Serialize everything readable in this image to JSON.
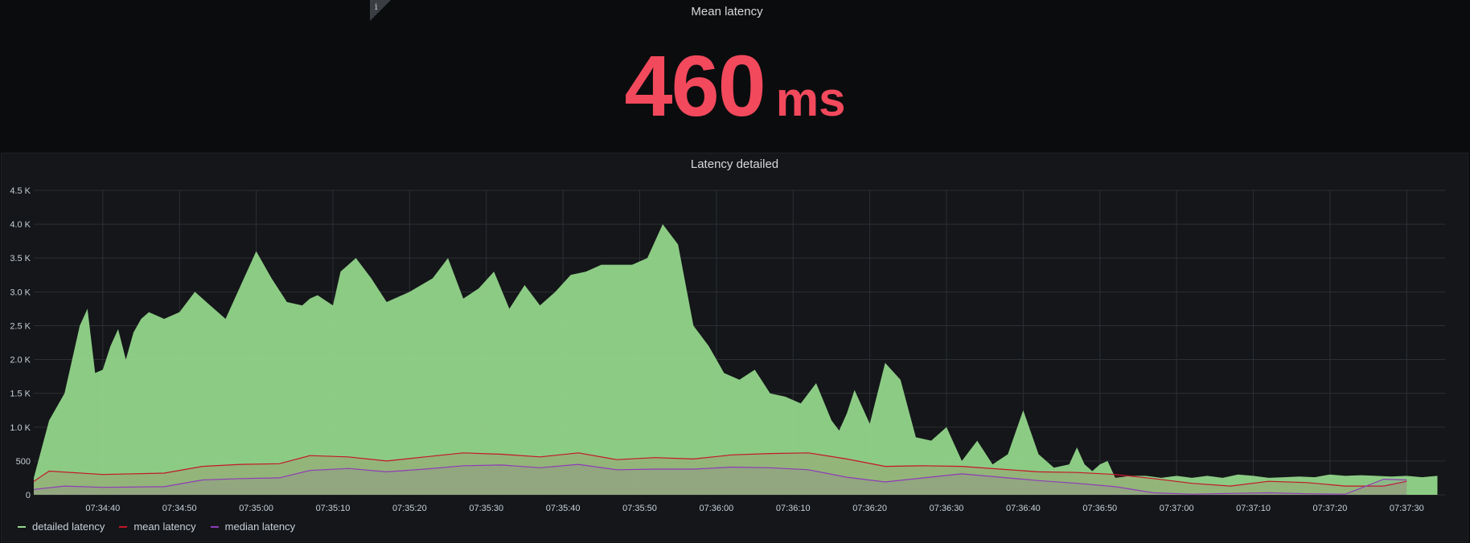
{
  "stat_panel": {
    "title": "Mean latency",
    "value": "460",
    "unit": "ms",
    "value_color": "#f2495c",
    "info_icon": "i"
  },
  "graph_panel": {
    "title": "Latency detailed"
  },
  "chart_data": {
    "type": "area",
    "title": "Latency detailed",
    "ylim": [
      0,
      4500
    ],
    "y_ticks": [
      "0",
      "500",
      "1.0 K",
      "1.5 K",
      "2.0 K",
      "2.5 K",
      "3.0 K",
      "3.5 K",
      "4.0 K",
      "4.5 K"
    ],
    "x_ticks": [
      "07:34:40",
      "07:34:50",
      "07:35:00",
      "07:35:10",
      "07:35:20",
      "07:35:30",
      "07:35:40",
      "07:35:50",
      "07:36:00",
      "07:36:10",
      "07:36:20",
      "07:36:30",
      "07:36:40",
      "07:36:50",
      "07:37:00",
      "07:37:10",
      "07:37:20",
      "07:37:30"
    ],
    "grid": true,
    "legend": "bottom-left",
    "series": [
      {
        "name": "detailed latency",
        "color": "#96d98d",
        "style": "area",
        "x": [
          "07:34:31",
          "07:34:33",
          "07:34:35",
          "07:34:36",
          "07:34:37",
          "07:34:38",
          "07:34:39",
          "07:34:40",
          "07:34:41",
          "07:34:42",
          "07:34:43",
          "07:34:44",
          "07:34:45",
          "07:34:46",
          "07:34:47",
          "07:34:48",
          "07:34:50",
          "07:34:52",
          "07:34:54",
          "07:34:56",
          "07:34:58",
          "07:35:00",
          "07:35:02",
          "07:35:04",
          "07:35:06",
          "07:35:07",
          "07:35:08",
          "07:35:10",
          "07:35:11",
          "07:35:13",
          "07:35:15",
          "07:35:17",
          "07:35:20",
          "07:35:23",
          "07:35:25",
          "07:35:27",
          "07:35:29",
          "07:35:31",
          "07:35:33",
          "07:35:35",
          "07:35:37",
          "07:35:39",
          "07:35:41",
          "07:35:43",
          "07:35:45",
          "07:35:47",
          "07:35:49",
          "07:35:51",
          "07:35:53",
          "07:35:55",
          "07:35:57",
          "07:35:59",
          "07:36:01",
          "07:36:03",
          "07:36:05",
          "07:36:07",
          "07:36:09",
          "07:36:11",
          "07:36:13",
          "07:36:15",
          "07:36:16",
          "07:36:17",
          "07:36:18",
          "07:36:20",
          "07:36:22",
          "07:36:24",
          "07:36:26",
          "07:36:28",
          "07:36:30",
          "07:36:32",
          "07:36:34",
          "07:36:36",
          "07:36:38",
          "07:36:40",
          "07:36:42",
          "07:36:44",
          "07:36:46",
          "07:36:47",
          "07:36:48",
          "07:36:49",
          "07:36:50",
          "07:36:51",
          "07:36:52",
          "07:36:54",
          "07:36:56",
          "07:36:58",
          "07:37:00",
          "07:37:02",
          "07:37:04",
          "07:37:06",
          "07:37:08",
          "07:37:10",
          "07:37:12",
          "07:37:14",
          "07:37:16",
          "07:37:18",
          "07:37:20",
          "07:37:22",
          "07:37:24",
          "07:37:26",
          "07:37:28",
          "07:37:30",
          "07:37:32",
          "07:37:34"
        ],
        "values": [
          250,
          1100,
          1500,
          2000,
          2500,
          2750,
          1800,
          1850,
          2200,
          2450,
          2000,
          2400,
          2600,
          2700,
          2650,
          2600,
          2700,
          3000,
          2800,
          2600,
          3100,
          3600,
          3200,
          2850,
          2800,
          2900,
          2950,
          2800,
          3300,
          3500,
          3200,
          2850,
          3000,
          3200,
          3500,
          2900,
          3050,
          3300,
          2750,
          3100,
          2800,
          3000,
          3250,
          3300,
          3400,
          3400,
          3400,
          3500,
          4000,
          3700,
          2500,
          2200,
          1800,
          1700,
          1850,
          1500,
          1450,
          1350,
          1650,
          1100,
          950,
          1200,
          1550,
          1050,
          1950,
          1700,
          850,
          800,
          1000,
          500,
          800,
          450,
          600,
          1250,
          600,
          400,
          450,
          700,
          450,
          350,
          450,
          500,
          250,
          280,
          280,
          250,
          280,
          250,
          280,
          250,
          300,
          280,
          250,
          260,
          270,
          260,
          300,
          280,
          290,
          280,
          270,
          280,
          260,
          280
        ]
      },
      {
        "name": "mean latency",
        "color": "#c4162a",
        "style": "line",
        "x": [
          "07:34:31",
          "07:34:33",
          "07:34:40",
          "07:34:48",
          "07:34:53",
          "07:34:58",
          "07:35:03",
          "07:35:07",
          "07:35:12",
          "07:35:17",
          "07:35:22",
          "07:35:27",
          "07:35:32",
          "07:35:37",
          "07:35:42",
          "07:35:47",
          "07:35:52",
          "07:35:57",
          "07:36:02",
          "07:36:07",
          "07:36:12",
          "07:36:17",
          "07:36:22",
          "07:36:27",
          "07:36:32",
          "07:36:37",
          "07:36:42",
          "07:36:47",
          "07:36:52",
          "07:36:57",
          "07:37:02",
          "07:37:07",
          "07:37:12",
          "07:37:17",
          "07:37:22",
          "07:37:27",
          "07:37:30"
        ],
        "values": [
          200,
          350,
          300,
          320,
          420,
          450,
          460,
          580,
          560,
          500,
          560,
          620,
          600,
          560,
          620,
          520,
          550,
          530,
          590,
          610,
          620,
          530,
          420,
          430,
          420,
          380,
          340,
          330,
          300,
          240,
          170,
          130,
          200,
          180,
          130,
          130,
          200
        ]
      },
      {
        "name": "median latency",
        "color": "#8f3bb8",
        "style": "line",
        "x": [
          "07:34:31",
          "07:34:35",
          "07:34:40",
          "07:34:48",
          "07:34:53",
          "07:34:58",
          "07:35:03",
          "07:35:07",
          "07:35:12",
          "07:35:17",
          "07:35:22",
          "07:35:27",
          "07:35:32",
          "07:35:37",
          "07:35:42",
          "07:35:47",
          "07:35:52",
          "07:35:57",
          "07:36:02",
          "07:36:07",
          "07:36:12",
          "07:36:17",
          "07:36:22",
          "07:36:27",
          "07:36:32",
          "07:36:37",
          "07:36:42",
          "07:36:47",
          "07:36:52",
          "07:36:57",
          "07:37:02",
          "07:37:07",
          "07:37:12",
          "07:37:17",
          "07:37:22",
          "07:37:27",
          "07:37:30"
        ],
        "values": [
          80,
          130,
          110,
          120,
          220,
          240,
          250,
          360,
          390,
          340,
          380,
          430,
          440,
          400,
          450,
          370,
          380,
          380,
          410,
          400,
          370,
          260,
          190,
          250,
          310,
          260,
          210,
          170,
          120,
          30,
          10,
          20,
          30,
          15,
          10,
          230,
          220
        ]
      }
    ]
  }
}
